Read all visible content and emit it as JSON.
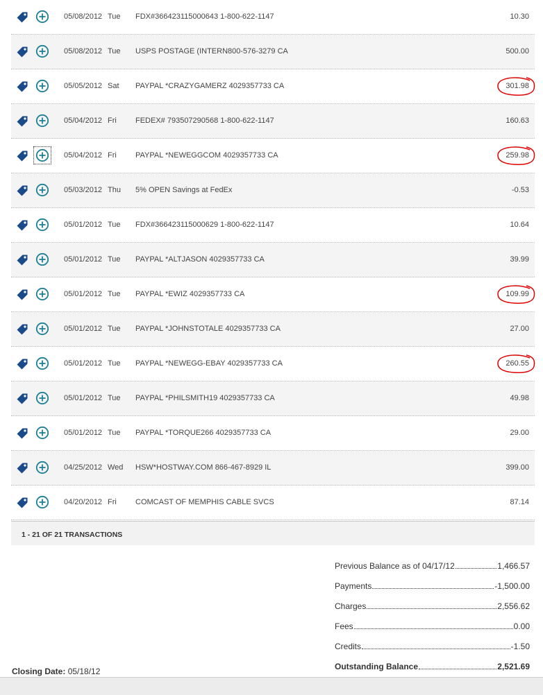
{
  "colors": {
    "icon_blue": "#1a4a8a",
    "plus_teal": "#1d7f97",
    "annotation_red": "#e00000",
    "row_alt": "#f4f4f4"
  },
  "icons": {
    "tag": "price-tag-icon",
    "add": "add-circle-icon"
  },
  "transactions": [
    {
      "date": "05/08/2012",
      "day": "Tue",
      "description": "FDX#366423115000643 1-800-622-1147",
      "amount": "10.30",
      "circled": false
    },
    {
      "date": "05/08/2012",
      "day": "Tue",
      "description": "USPS POSTAGE (INTERN800-576-3279 CA",
      "amount": "500.00",
      "circled": false
    },
    {
      "date": "05/05/2012",
      "day": "Sat",
      "description": "PAYPAL *CRAZYGAMERZ 4029357733 CA",
      "amount": "301.98",
      "circled": true
    },
    {
      "date": "05/04/2012",
      "day": "Fri",
      "description": "FEDEX# 793507290568 1-800-622-1147",
      "amount": "160.63",
      "circled": false
    },
    {
      "date": "05/04/2012",
      "day": "Fri",
      "description": "PAYPAL *NEWEGGCOM 4029357733 CA",
      "amount": "259.98",
      "circled": true
    },
    {
      "date": "05/03/2012",
      "day": "Thu",
      "description": "5% OPEN Savings at FedEx",
      "amount": "-0.53",
      "circled": false
    },
    {
      "date": "05/01/2012",
      "day": "Tue",
      "description": "FDX#366423115000629 1-800-622-1147",
      "amount": "10.64",
      "circled": false
    },
    {
      "date": "05/01/2012",
      "day": "Tue",
      "description": "PAYPAL *ALTJASON 4029357733 CA",
      "amount": "39.99",
      "circled": false
    },
    {
      "date": "05/01/2012",
      "day": "Tue",
      "description": "PAYPAL *EWIZ 4029357733 CA",
      "amount": "109.99",
      "circled": true
    },
    {
      "date": "05/01/2012",
      "day": "Tue",
      "description": "PAYPAL *JOHNSTOTALE 4029357733 CA",
      "amount": "27.00",
      "circled": false
    },
    {
      "date": "05/01/2012",
      "day": "Tue",
      "description": "PAYPAL *NEWEGG-EBAY 4029357733 CA",
      "amount": "260.55",
      "circled": true
    },
    {
      "date": "05/01/2012",
      "day": "Tue",
      "description": "PAYPAL *PHILSMITH19 4029357733 CA",
      "amount": "49.98",
      "circled": false
    },
    {
      "date": "05/01/2012",
      "day": "Tue",
      "description": "PAYPAL *TORQUE266 4029357733 CA",
      "amount": "29.00",
      "circled": false
    },
    {
      "date": "04/25/2012",
      "day": "Wed",
      "description": "HSW*HOSTWAY.COM 866-467-8929 IL",
      "amount": "399.00",
      "circled": false
    },
    {
      "date": "04/20/2012",
      "day": "Fri",
      "description": "COMCAST OF MEMPHIS CABLE SVCS",
      "amount": "87.14",
      "circled": false
    }
  ],
  "footer": {
    "count_label": "1 - 21 OF 21 TRANSACTIONS"
  },
  "summary": {
    "previous_balance_label": "Previous Balance as of 04/17/12",
    "previous_balance_value": "1,466.57",
    "payments_label": "Payments",
    "payments_value": "-1,500.00",
    "charges_label": "Charges",
    "charges_value": "2,556.62",
    "fees_label": "Fees",
    "fees_value": "0.00",
    "credits_label": "Credits",
    "credits_value": "-1.50",
    "outstanding_label": "Outstanding Balance",
    "outstanding_value": "2,521.69"
  },
  "closing": {
    "label": "Closing Date:",
    "value": "05/18/12"
  }
}
